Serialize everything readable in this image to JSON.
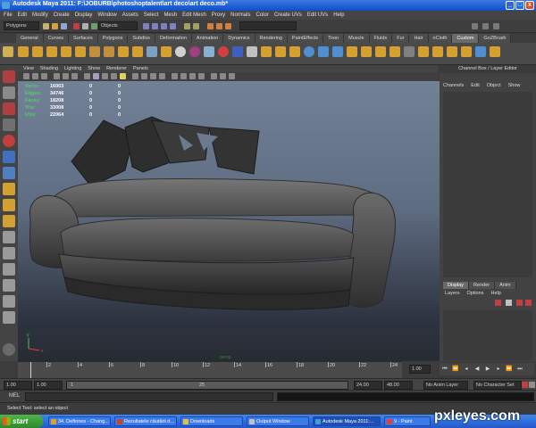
{
  "window": {
    "title": "Autodesk Maya 2011: F:\\JOBURB\\photoshoptalent\\art deco\\art deco.mb*",
    "minimize": "_",
    "maximize": "□",
    "close": "x"
  },
  "menubar": [
    "File",
    "Edit",
    "Modify",
    "Create",
    "Display",
    "Window",
    "Assets",
    "Select",
    "Mesh",
    "Edit Mesh",
    "Proxy",
    "Normals",
    "Color",
    "Create UVs",
    "Edit UVs",
    "Help"
  ],
  "statusline": {
    "menuset": "Polygons",
    "object_field": "Objects"
  },
  "shelf": {
    "tabs": [
      "General",
      "Curves",
      "Surfaces",
      "Polygons",
      "Subdivs",
      "Deformation",
      "Animation",
      "Dynamics",
      "Rendering",
      "PaintEffects",
      "Toon",
      "Muscle",
      "Fluids",
      "Fur",
      "Hair",
      "nCloth",
      "Custom",
      "GoZBrush"
    ],
    "active_tab": "Custom"
  },
  "panel": {
    "menus": [
      "View",
      "Shading",
      "Lighting",
      "Show",
      "Renderer",
      "Panels"
    ]
  },
  "hud": [
    {
      "label": "Verts:",
      "values": [
        "16003",
        "0",
        "0"
      ]
    },
    {
      "label": "Edges:",
      "values": [
        "34746",
        "0",
        "0"
      ]
    },
    {
      "label": "Faces:",
      "values": [
        "18208",
        "0",
        "0"
      ]
    },
    {
      "label": "Tris:",
      "values": [
        "33008",
        "0",
        "0"
      ]
    },
    {
      "label": "UVs:",
      "values": [
        "22064",
        "0",
        "0"
      ]
    }
  ],
  "viewport": {
    "camera_label": "persp",
    "axis": {
      "x": "x",
      "y": "y"
    }
  },
  "channelbox": {
    "title": "Channel Box / Layer Editor",
    "menus": [
      "Channels",
      "Edit",
      "Object",
      "Show"
    ],
    "layer_tabs": [
      "Display",
      "Render",
      "Anim"
    ],
    "active_layer_tab": "Display",
    "layer_menus": [
      "Layers",
      "Options",
      "Help"
    ]
  },
  "timeslider": {
    "ticks": [
      "2",
      "4",
      "6",
      "8",
      "10",
      "12",
      "14",
      "16",
      "18",
      "20",
      "22",
      "24"
    ],
    "current_frame": "1.00"
  },
  "range": {
    "start": "1.00",
    "start2": "1.00",
    "slider_start": "1",
    "slider_end": "25",
    "end": "24.00",
    "end2": "48.00",
    "anim_layer": "No Anim Layer",
    "char_set": "No Character Set"
  },
  "cmdline": {
    "label": "MEL"
  },
  "helpline": {
    "text": "Select Tool: select an object"
  },
  "taskbar": {
    "start_label": "start",
    "tasks": [
      {
        "label": "34. Deftones - Chang...",
        "color": "#e0a020"
      },
      {
        "label": "Rezultatele căutării d...",
        "color": "#d04020"
      },
      {
        "label": "Downloads",
        "color": "#e0c040"
      },
      {
        "label": "Output Window",
        "color": "#c0c0c0"
      },
      {
        "label": "Autodesk Maya 2011:...",
        "color": "#40a0d0"
      },
      {
        "label": "9 - Paint",
        "color": "#e04040"
      }
    ]
  },
  "watermark": "pxleyes.com"
}
